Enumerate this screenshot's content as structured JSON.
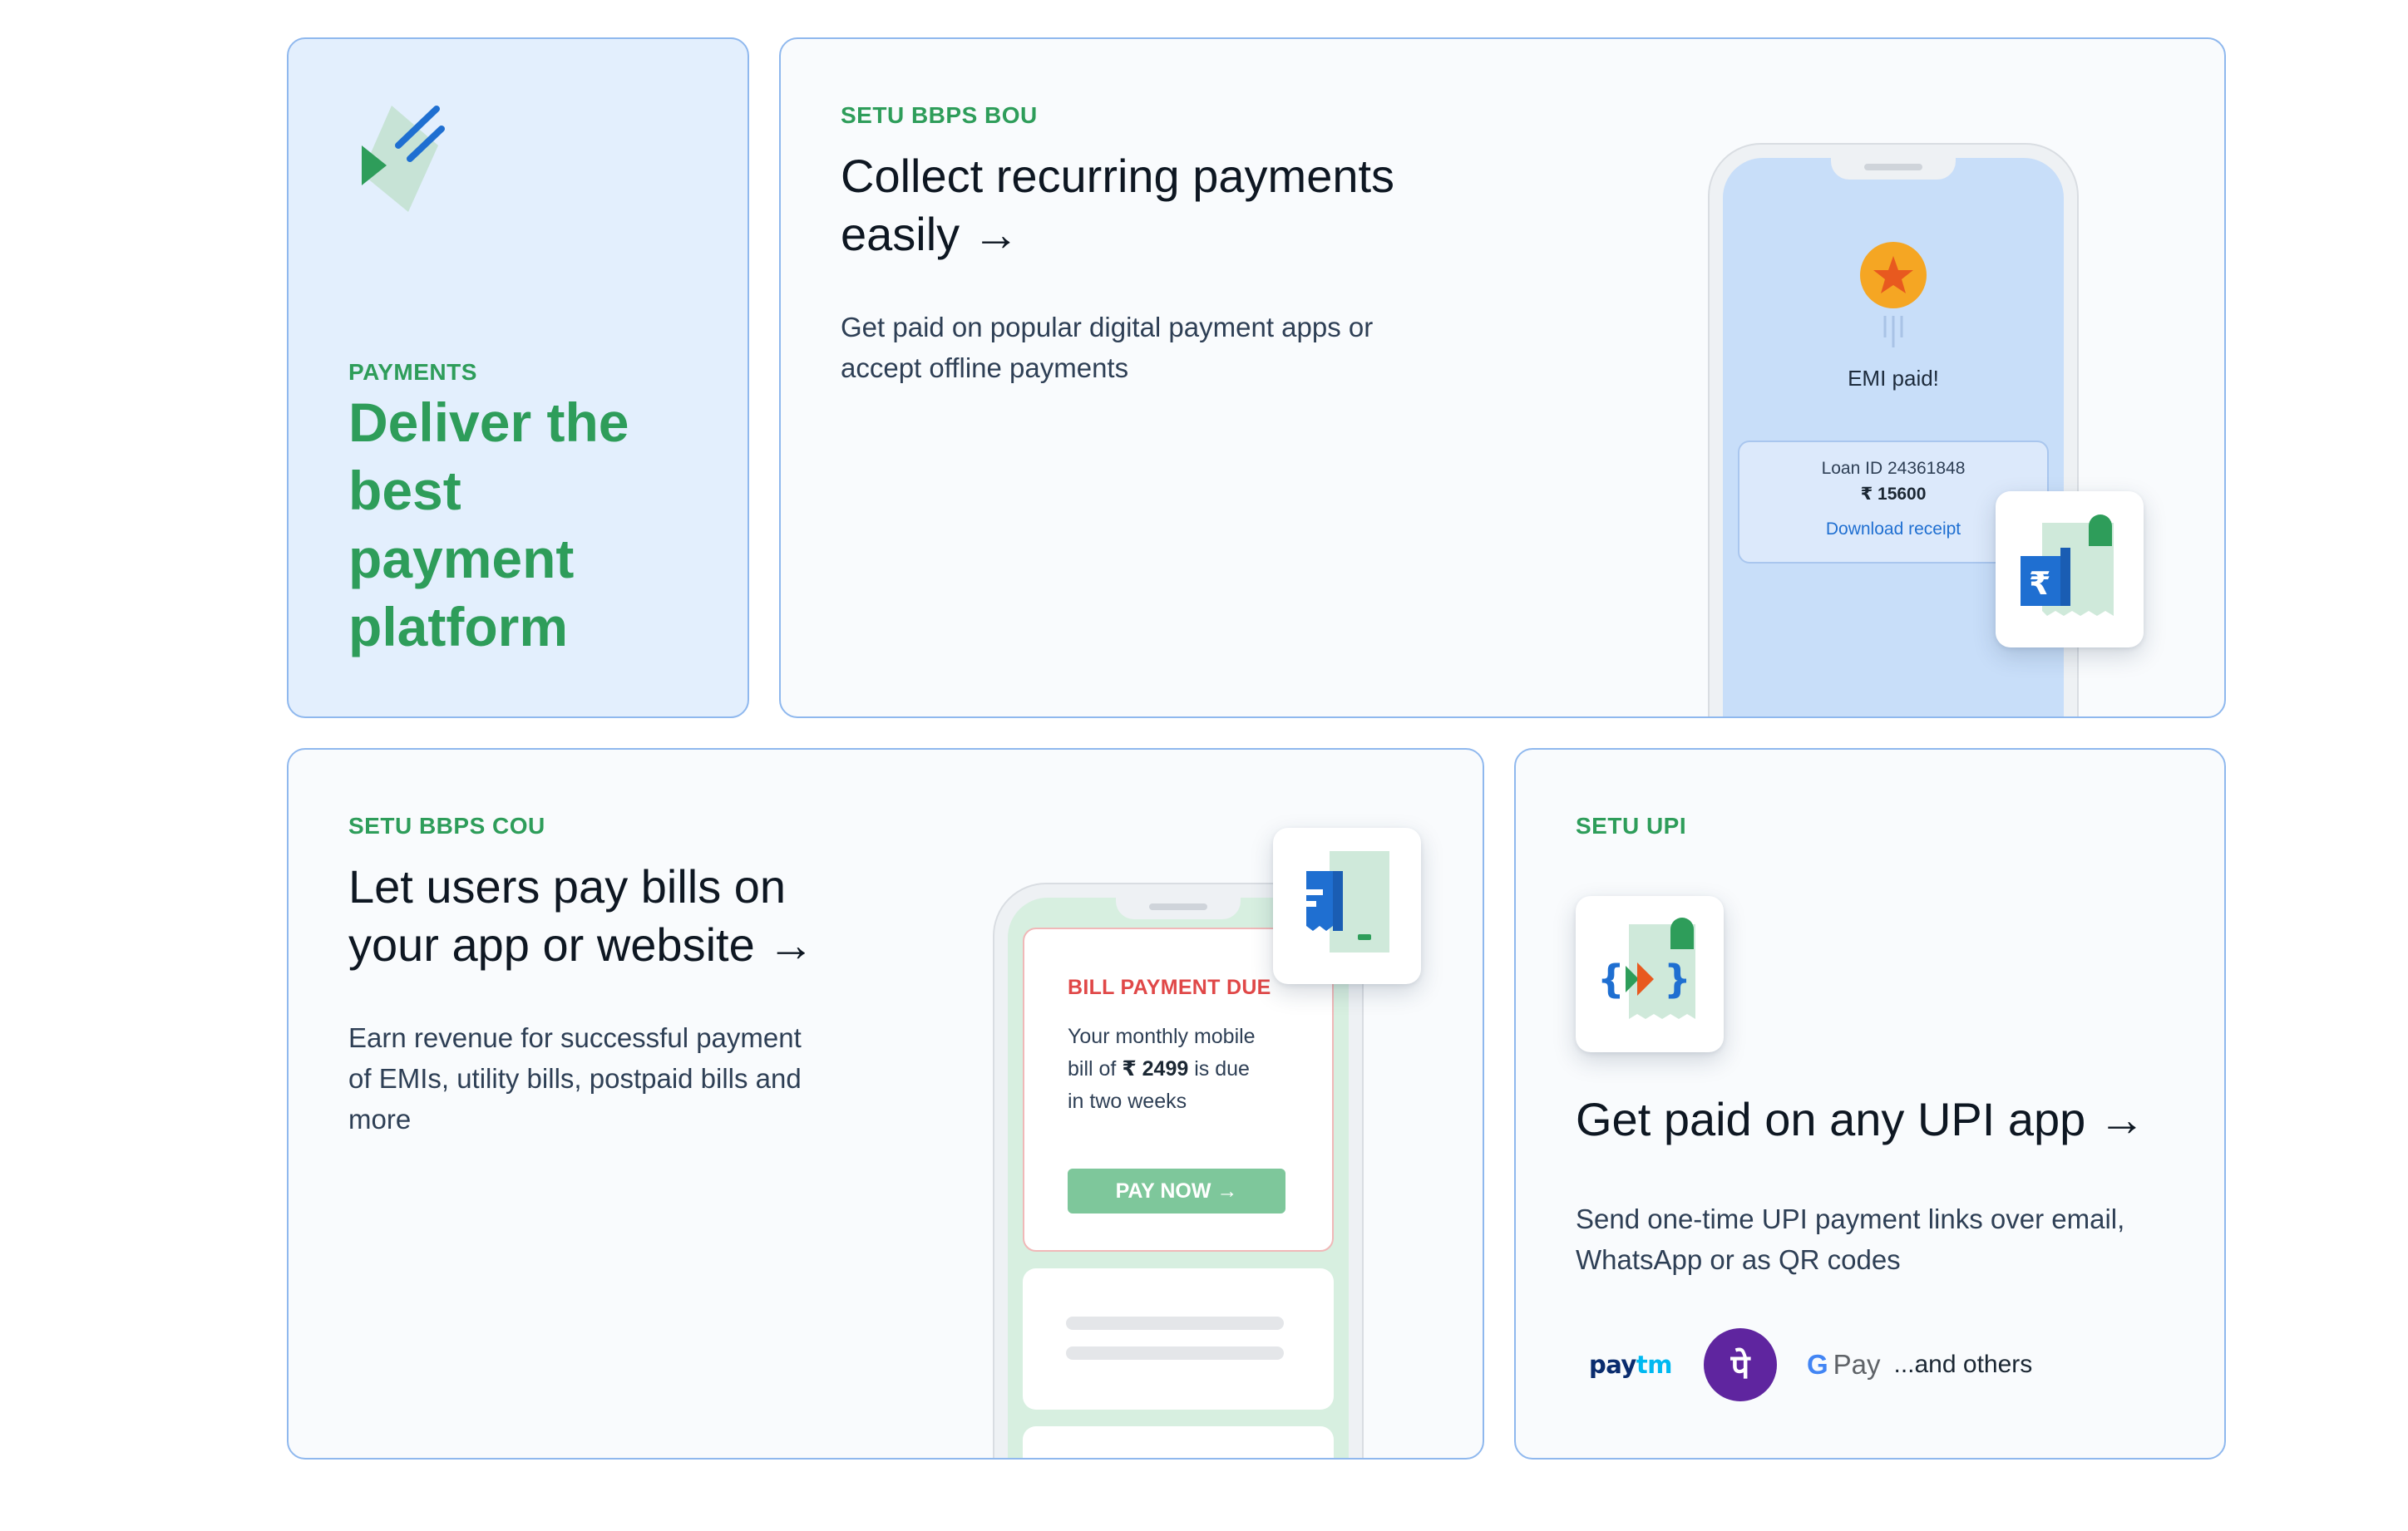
{
  "payments_card": {
    "kicker": "PAYMENTS",
    "headline_lines": [
      "Deliver the",
      "best",
      "payment",
      "platform"
    ],
    "icon": "payments-document-icon"
  },
  "bou_card": {
    "kicker": "SETU BBPS BOU",
    "title_line1": "Collect recurring payments",
    "title_line2": "easily →",
    "desc_line1": "Get paid on popular digital payment apps or",
    "desc_line2": "accept offline payments",
    "phone": {
      "status": "EMI paid!",
      "loan_id": "Loan ID 24361848",
      "amount": "₹ 15600",
      "receipt_link": "Download receipt"
    },
    "tile_icon": "rupee-receipt-icon"
  },
  "cou_card": {
    "kicker": "SETU BBPS COU",
    "title_line1": "Let users pay bills on",
    "title_line2": "your app or website →",
    "desc_line1": "Earn revenue for successful payment",
    "desc_line2": "of EMIs, utility bills, postpaid bills and",
    "desc_line3": "more",
    "phone": {
      "bill_title": "BILL PAYMENT DUE",
      "msg_line1": "Your monthly mobile",
      "msg_pre": "bill of ",
      "msg_amount": "₹ 2499",
      "msg_post": " is due",
      "msg_line3": "in two weeks",
      "pay_button": "PAY NOW →"
    },
    "tile_icon": "bill-document-icon"
  },
  "upi_card": {
    "kicker": "SETU UPI",
    "title": "Get paid on any UPI app →",
    "desc_line1": "Send one-time UPI payment links over email,",
    "desc_line2": "WhatsApp or as QR codes",
    "apps": {
      "paytm_pay": "pay",
      "paytm_tm": "tm",
      "phonepe_glyph": "पे",
      "gpay_g": "G",
      "gpay_pay": "Pay",
      "others": "...and others"
    },
    "tile_icon": "upi-code-icon"
  },
  "colors": {
    "accent_green": "#2e9d5a",
    "card_border": "#8fb8ee",
    "payments_bg": "#e3effd",
    "phone_blue": "#c8def9",
    "phone_mint": "#d7efe0",
    "bill_red": "#e04848",
    "pay_button": "#7ec79b",
    "link_blue": "#1f6fd1",
    "phonepe_purple": "#5f259f",
    "paytm_navy": "#0a2c6e",
    "paytm_sky": "#00b9f1"
  }
}
